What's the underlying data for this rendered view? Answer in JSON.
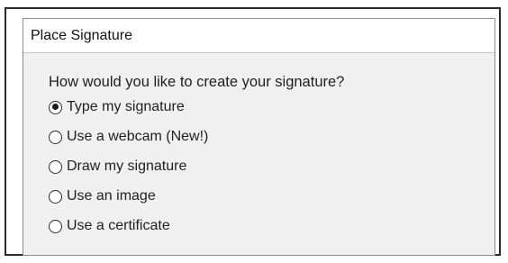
{
  "dialog": {
    "title": "Place Signature",
    "question": "How would you like to create your signature?",
    "options": [
      {
        "label": "Type my signature",
        "selected": true
      },
      {
        "label": "Use a webcam (New!)",
        "selected": false
      },
      {
        "label": "Draw my signature",
        "selected": false
      },
      {
        "label": "Use an image",
        "selected": false
      },
      {
        "label": "Use a certificate",
        "selected": false
      }
    ]
  }
}
